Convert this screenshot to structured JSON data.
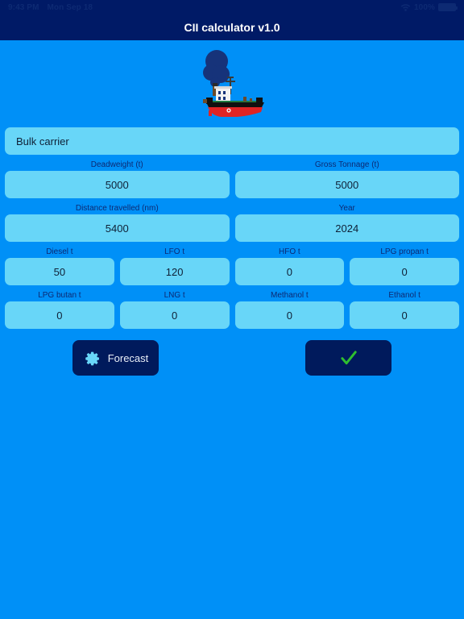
{
  "status_bar": {
    "time": "9:43 PM",
    "date": "Mon Sep 18",
    "battery_percent": "100%",
    "wifi_icon": "wifi-icon",
    "battery_icon": "battery-icon"
  },
  "app": {
    "title": "CII calculator v1.0",
    "hero_icon": "ship-icon"
  },
  "form": {
    "vessel_type": {
      "value": "Bulk carrier"
    },
    "rows": [
      {
        "cells": [
          {
            "label": "Deadweight (t)",
            "value": "5000",
            "name": "deadweight"
          },
          {
            "label": "Gross Tonnage (t)",
            "value": "5000",
            "name": "gross-tonnage"
          }
        ]
      },
      {
        "cells": [
          {
            "label": "Distance travelled (nm)",
            "value": "5400",
            "name": "distance-travelled"
          },
          {
            "label": "Year",
            "value": "2024",
            "name": "year"
          }
        ]
      },
      {
        "cells": [
          {
            "label": "Diesel t",
            "value": "50",
            "name": "diesel"
          },
          {
            "label": "LFO t",
            "value": "120",
            "name": "lfo"
          },
          {
            "label": "HFO t",
            "value": "0",
            "name": "hfo"
          },
          {
            "label": "LPG propan t",
            "value": "0",
            "name": "lpg-propan"
          }
        ]
      },
      {
        "cells": [
          {
            "label": "LPG butan t",
            "value": "0",
            "name": "lpg-butan"
          },
          {
            "label": "LNG t",
            "value": "0",
            "name": "lng"
          },
          {
            "label": "Methanol t",
            "value": "0",
            "name": "methanol"
          },
          {
            "label": "Ethanol t",
            "value": "0",
            "name": "ethanol"
          }
        ]
      }
    ]
  },
  "buttons": {
    "forecast": {
      "label": "Forecast",
      "icon": "gear-icon"
    },
    "confirm": {
      "label": "",
      "icon": "check-icon"
    }
  },
  "colors": {
    "background": "#0090f7",
    "navy": "#001a66",
    "field": "#68d6f8",
    "button": "#001a5c",
    "check_green": "#2fbf2f",
    "gear_blue": "#68d6f8",
    "label_text": "#0d2a73"
  }
}
